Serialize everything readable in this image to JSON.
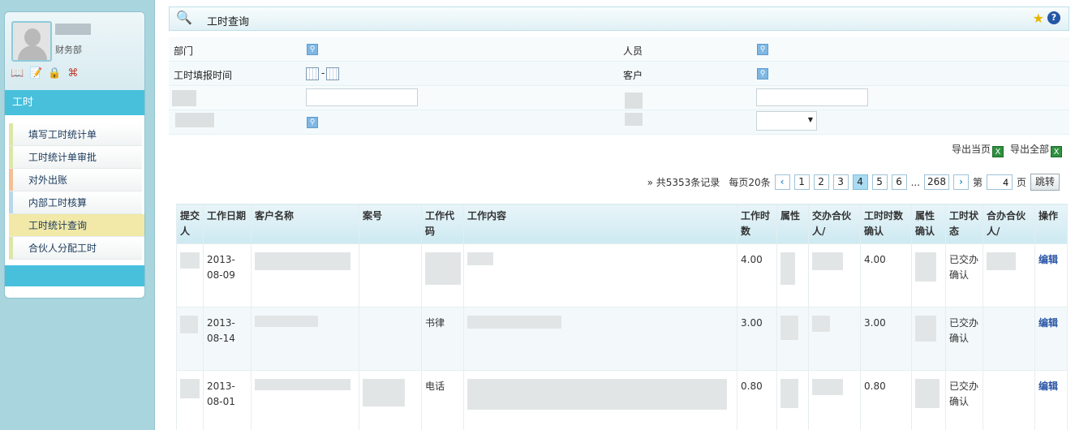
{
  "sidebar": {
    "department": "财务部",
    "module_title": "工时",
    "menu": [
      {
        "label": "填写工时统计单",
        "color": "#dce6a6"
      },
      {
        "label": "工时统计单审批",
        "color": "#dce6a6"
      },
      {
        "label": "对外出账",
        "color": "#f5bf95"
      },
      {
        "label": "内部工时核算",
        "color": "#b8d8ea"
      },
      {
        "label": "工时统计查询",
        "color": "#f2e9a8"
      },
      {
        "label": "合伙人分配工时",
        "color": "#dce6a6"
      }
    ],
    "active_index": 4
  },
  "page": {
    "title": "工时查询"
  },
  "form": {
    "dept_label": "部门",
    "person_label": "人员",
    "report_time_label": "工时填报时间",
    "time_separator": "-",
    "client_label": "客户"
  },
  "export": {
    "current_page": "导出当页",
    "all": "导出全部"
  },
  "pager": {
    "summary": "» 共5353条记录",
    "per_page": "每页20条",
    "pages": [
      "1",
      "2",
      "3",
      "4",
      "5",
      "6"
    ],
    "current": "4",
    "ellipsis": "...",
    "last": "268",
    "goto_prefix": "第",
    "goto_value": "4",
    "goto_suffix": "页",
    "jump": "跳转"
  },
  "table": {
    "headers": [
      "提交人",
      "工作日期",
      "客户名称",
      "案号",
      "工作代码",
      "工作内容",
      "工作时数",
      "属性",
      "交办合伙人/",
      "工时时数确认",
      "属性确认",
      "工时状态",
      "合办合伙人/",
      "操作"
    ],
    "rows": [
      {
        "date": "2013-08-09",
        "code": "",
        "hours": "4.00",
        "confirmed_hours": "4.00",
        "status": "已交办确认",
        "action": "编辑"
      },
      {
        "date": "2013-08-14",
        "code": "书律",
        "hours": "3.00",
        "confirmed_hours": "3.00",
        "status": "已交办确认",
        "action": "编辑"
      },
      {
        "date": "2013-08-01",
        "code": "电话",
        "hours": "0.80",
        "confirmed_hours": "0.80",
        "status": "已交办确认",
        "action": "编辑"
      }
    ]
  }
}
